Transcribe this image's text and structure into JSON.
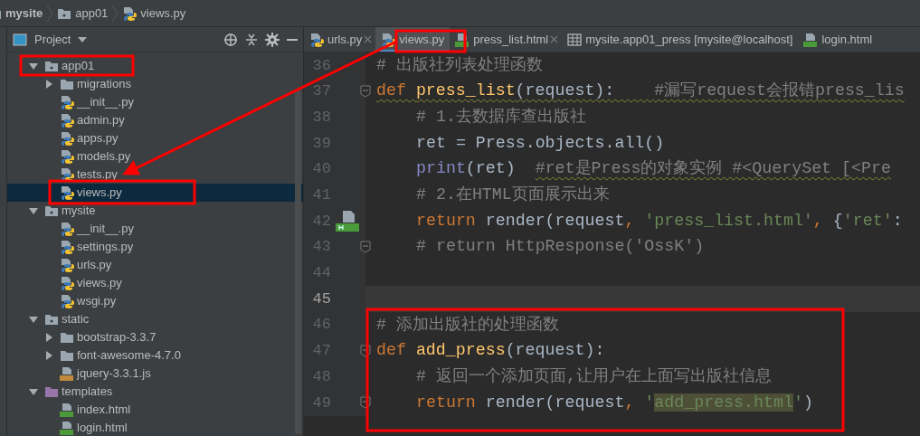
{
  "breadcrumb": [
    {
      "label": "mysite",
      "kind": "project"
    },
    {
      "label": "app01",
      "kind": "package"
    },
    {
      "label": "views.py",
      "kind": "python"
    }
  ],
  "project_panel": {
    "title": "Project",
    "tree": [
      {
        "label": "app01",
        "kind": "package",
        "expanded": true,
        "selected": false,
        "children": [
          {
            "label": "migrations",
            "kind": "folder",
            "expanded": false,
            "selected": false
          },
          {
            "label": "__init__.py",
            "kind": "python",
            "selected": false
          },
          {
            "label": "admin.py",
            "kind": "python",
            "selected": false
          },
          {
            "label": "apps.py",
            "kind": "python",
            "selected": false
          },
          {
            "label": "models.py",
            "kind": "python",
            "selected": false
          },
          {
            "label": "tests.py",
            "kind": "python",
            "selected": false
          },
          {
            "label": "views.py",
            "kind": "python",
            "selected": true
          }
        ]
      },
      {
        "label": "mysite",
        "kind": "package",
        "expanded": true,
        "selected": false,
        "children": [
          {
            "label": "__init__.py",
            "kind": "python",
            "selected": false
          },
          {
            "label": "settings.py",
            "kind": "python",
            "selected": false
          },
          {
            "label": "urls.py",
            "kind": "python",
            "selected": false
          },
          {
            "label": "views.py",
            "kind": "python",
            "selected": false
          },
          {
            "label": "wsgi.py",
            "kind": "python",
            "selected": false
          }
        ]
      },
      {
        "label": "static",
        "kind": "package",
        "expanded": true,
        "selected": false,
        "children": [
          {
            "label": "bootstrap-3.3.7",
            "kind": "folder",
            "expanded": false,
            "selected": false
          },
          {
            "label": "font-awesome-4.7.0",
            "kind": "folder",
            "expanded": false,
            "selected": false
          },
          {
            "label": "jquery-3.3.1.js",
            "kind": "js",
            "selected": false
          }
        ]
      },
      {
        "label": "templates",
        "kind": "templates",
        "expanded": true,
        "selected": false,
        "children": [
          {
            "label": "index.html",
            "kind": "html",
            "selected": false
          },
          {
            "label": "login.html",
            "kind": "html",
            "selected": false
          }
        ]
      }
    ]
  },
  "tabs": [
    {
      "label": "urls.py",
      "kind": "python",
      "selected": false,
      "closable": true
    },
    {
      "label": "views.py",
      "kind": "python",
      "selected": true,
      "closable": false
    },
    {
      "label": "press_list.html",
      "kind": "html",
      "selected": false,
      "closable": true
    },
    {
      "label": "mysite.app01_press [mysite@localhost]",
      "kind": "table",
      "selected": false,
      "closable": false
    },
    {
      "label": "login.html",
      "kind": "html",
      "selected": false,
      "closable": false
    }
  ],
  "editor": {
    "lines": [
      {
        "number": "36",
        "indented": false,
        "current": false,
        "fold": false,
        "gutter_icon": false,
        "tokens": [
          {
            "text": "# 出版社列表处理函数",
            "kind": "comment",
            "wavy": false
          }
        ]
      },
      {
        "number": "37",
        "indented": false,
        "current": false,
        "fold": true,
        "gutter_icon": false,
        "tokens": [
          {
            "text": "def ",
            "kind": "keyword",
            "wavy": true
          },
          {
            "text": "press_list",
            "kind": "function",
            "wavy": true
          },
          {
            "text": "(request):    ",
            "kind": "plain",
            "wavy": true
          },
          {
            "text": "#漏写request会报错press_lis",
            "kind": "comment",
            "wavy": true
          }
        ]
      },
      {
        "number": "38",
        "indented": true,
        "current": false,
        "fold": false,
        "gutter_icon": false,
        "tokens": [
          {
            "text": "# 1.去数据库查出版社",
            "kind": "comment",
            "wavy": false
          }
        ]
      },
      {
        "number": "39",
        "indented": true,
        "current": false,
        "fold": false,
        "gutter_icon": false,
        "tokens": [
          {
            "text": "ret = Press.objects.all()",
            "kind": "plain",
            "wavy": false
          }
        ]
      },
      {
        "number": "40",
        "indented": true,
        "current": false,
        "fold": false,
        "gutter_icon": false,
        "tokens": [
          {
            "text": "print",
            "kind": "builtin",
            "wavy": false
          },
          {
            "text": "(ret)  ",
            "kind": "plain",
            "wavy": false
          },
          {
            "text": "#ret是Press的对象实例 #<QuerySet [<Pre",
            "kind": "comment",
            "wavy": true
          }
        ]
      },
      {
        "number": "41",
        "indented": true,
        "current": false,
        "fold": false,
        "gutter_icon": false,
        "tokens": [
          {
            "text": "# 2.在HTML页面展示出来",
            "kind": "comment",
            "wavy": false
          }
        ]
      },
      {
        "number": "42",
        "indented": true,
        "current": false,
        "fold": false,
        "gutter_icon": true,
        "tokens": [
          {
            "text": "return",
            "kind": "keyword",
            "wavy": false
          },
          {
            "text": " render(request",
            "kind": "plain",
            "wavy": false
          },
          {
            "text": ", ",
            "kind": "keyword",
            "wavy": false
          },
          {
            "text": "'press_list.html'",
            "kind": "string",
            "wavy": false
          },
          {
            "text": ", ",
            "kind": "keyword",
            "wavy": false
          },
          {
            "text": "{",
            "kind": "plain",
            "wavy": false
          },
          {
            "text": "'ret'",
            "kind": "string",
            "wavy": false
          },
          {
            "text": ":",
            "kind": "plain",
            "wavy": false
          }
        ]
      },
      {
        "number": "43",
        "indented": true,
        "current": false,
        "fold": true,
        "gutter_icon": false,
        "tokens": [
          {
            "text": "# return HttpResponse('OssK')",
            "kind": "comment",
            "wavy": false
          }
        ]
      },
      {
        "number": "44",
        "current": false,
        "fold": false,
        "gutter_icon": false
      },
      {
        "number": "45",
        "current": true,
        "fold": false,
        "gutter_icon": false
      },
      {
        "number": "46",
        "indented": false,
        "current": false,
        "fold": false,
        "gutter_icon": false,
        "tokens": [
          {
            "text": "# 添加出版社的处理函数",
            "kind": "comment",
            "wavy": false
          }
        ]
      },
      {
        "number": "47",
        "indented": false,
        "current": false,
        "fold": true,
        "gutter_icon": false,
        "tokens": [
          {
            "text": "def ",
            "kind": "keyword",
            "wavy": false
          },
          {
            "text": "add_press",
            "kind": "function",
            "wavy": false
          },
          {
            "text": "(request):",
            "kind": "plain",
            "wavy": false
          }
        ]
      },
      {
        "number": "48",
        "indented": true,
        "current": false,
        "fold": false,
        "gutter_icon": false,
        "tokens": [
          {
            "text": "# 返回一个添加页面,让用户在上面写出版社信息",
            "kind": "comment",
            "wavy": false
          }
        ]
      },
      {
        "number": "49",
        "indented": true,
        "current": false,
        "fold": true,
        "gutter_icon": false,
        "tokens": [
          {
            "text": "return",
            "kind": "keyword",
            "wavy": false
          },
          {
            "text": " render(request",
            "kind": "plain",
            "wavy": false
          },
          {
            "text": ", ",
            "kind": "keyword",
            "wavy": false
          },
          {
            "text": "'",
            "kind": "string",
            "wavy": false
          },
          {
            "text": "add_press.html",
            "kind": "string-match",
            "wavy": false
          },
          {
            "text": "'",
            "kind": "string",
            "wavy": false
          },
          {
            "text": ")",
            "kind": "plain",
            "wavy": false
          }
        ]
      }
    ]
  }
}
